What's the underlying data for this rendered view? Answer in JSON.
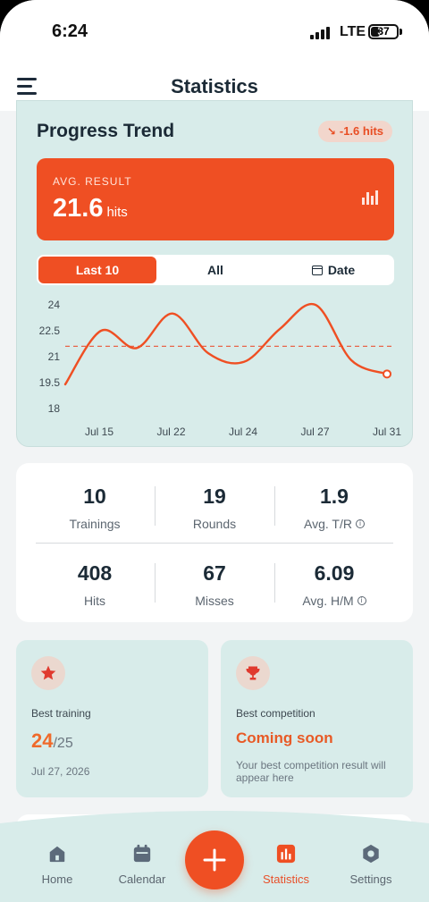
{
  "status_bar": {
    "time": "6:24",
    "network": "LTE",
    "battery": "37",
    "battery_level": 0.37
  },
  "header": {
    "title": "Statistics"
  },
  "progress": {
    "title": "Progress Trend",
    "delta": "-1.6 hits",
    "avg_label": "AVG. RESULT",
    "avg_value": "21.6",
    "avg_unit": "hits",
    "tabs": [
      "Last 10",
      "All",
      "Date"
    ],
    "active_tab": 0
  },
  "chart_data": {
    "type": "line",
    "title": "",
    "xlabel": "",
    "ylabel": "",
    "y_ticks": [
      "24",
      "22.5",
      "21",
      "19.5",
      "18"
    ],
    "ylim": [
      18,
      24
    ],
    "x_ticks": [
      "Jul 15",
      "Jul 22",
      "Jul 24",
      "Jul 27",
      "Jul 31"
    ],
    "values": [
      19.4,
      22.5,
      21.5,
      23.5,
      21.2,
      20.7,
      22.6,
      24.0,
      20.8,
      20.0
    ],
    "average": 21.6,
    "grid": false,
    "colors": {
      "line": "#ef4f23",
      "average": "#e8654a"
    }
  },
  "stats": [
    {
      "value": "10",
      "label": "Trainings",
      "info": false
    },
    {
      "value": "19",
      "label": "Rounds",
      "info": false
    },
    {
      "value": "1.9",
      "label": "Avg. T/R",
      "info": true
    },
    {
      "value": "408",
      "label": "Hits",
      "info": false
    },
    {
      "value": "67",
      "label": "Misses",
      "info": false
    },
    {
      "value": "6.09",
      "label": "Avg. H/M",
      "info": true
    }
  ],
  "best_training": {
    "label": "Best training",
    "score": "24",
    "total": "/25",
    "date": "Jul 27, 2026"
  },
  "best_competition": {
    "label": "Best competition",
    "status": "Coming soon",
    "description": "Your best competition result will appear here"
  },
  "nav": {
    "items": [
      "Home",
      "Calendar",
      "Statistics",
      "Settings"
    ],
    "active": 2
  },
  "colors": {
    "accent": "#ef4f23",
    "card_bg": "#d8ecea",
    "text_dark": "#1b2a36"
  }
}
